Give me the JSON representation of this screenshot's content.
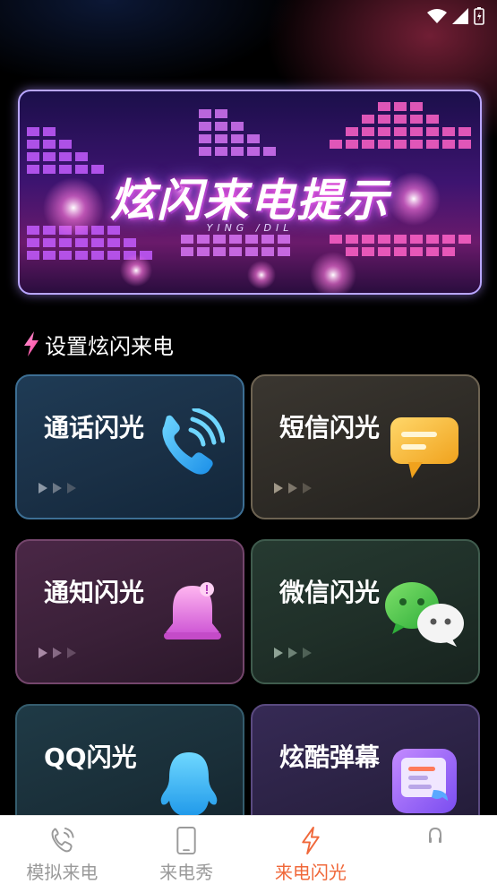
{
  "banner": {
    "title": "炫闪来电提示",
    "subtitle": "YING /DIL"
  },
  "section": {
    "title": "设置炫闪来电",
    "icon": "lightning-icon",
    "accent": "#ff5fb2"
  },
  "cards": [
    {
      "label": "通话闪光",
      "icon": "phone-icon"
    },
    {
      "label": "短信闪光",
      "icon": "message-icon"
    },
    {
      "label": "通知闪光",
      "icon": "bell-icon"
    },
    {
      "label": "微信闪光",
      "icon": "wechat-icon"
    },
    {
      "label": "QQ闪光",
      "icon": "qq-icon"
    },
    {
      "label": "炫酷弹幕",
      "icon": "barrage-icon"
    }
  ],
  "tabs": [
    {
      "label": "模拟来电",
      "icon": "phone-signal-icon",
      "active": false
    },
    {
      "label": "来电秀",
      "icon": "phone-device-icon",
      "active": false
    },
    {
      "label": "来电闪光",
      "icon": "lightning-icon",
      "active": true
    },
    {
      "label": "",
      "icon": "headphone-icon",
      "active": false
    }
  ],
  "colors": {
    "tab_active": "#f0683a",
    "tab_inactive": "#9a9a9a"
  }
}
